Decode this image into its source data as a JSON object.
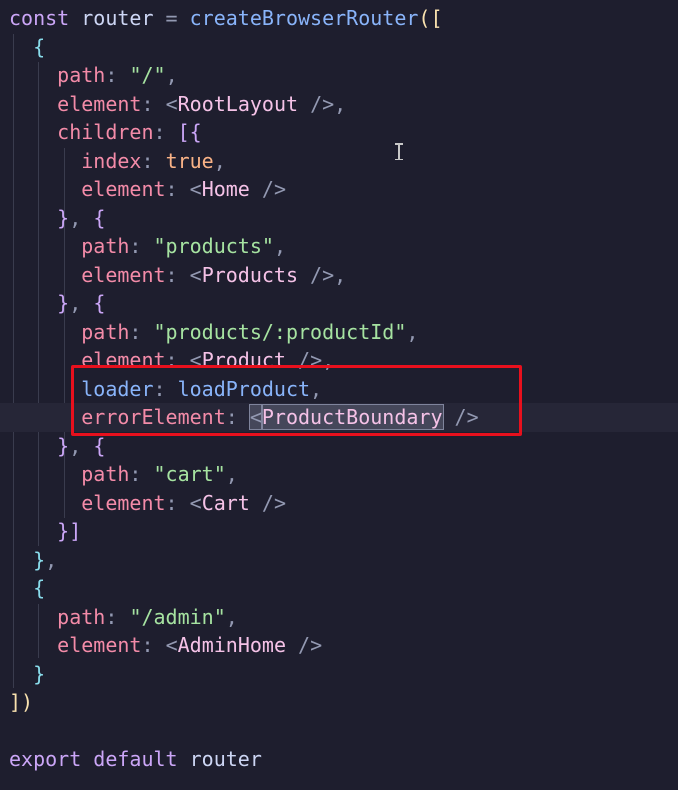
{
  "editor": {
    "language": "javascript",
    "theme_colors": {
      "background": "#1e1e2e",
      "keyword": "#cba6f7",
      "function": "#89b4fa",
      "property": "#f38ba8",
      "string": "#a6e3a1",
      "constant": "#fab387",
      "highlight_box": "#e8101d"
    },
    "lines": {
      "l1": {
        "kw1": "const",
        "name": "router",
        "eq": " = ",
        "fn": "createBrowserRouter",
        "open": "(["
      },
      "l2": {
        "brace": "{"
      },
      "l3": {
        "key": "path",
        "colon": ": ",
        "value": "\"/\"",
        "comma": ","
      },
      "l4": {
        "key": "element",
        "colon": ": ",
        "lt": "<",
        "tag": "RootLayout",
        "close": " />",
        "comma": ","
      },
      "l5": {
        "key": "children",
        "colon": ": ",
        "open": "[{"
      },
      "l6": {
        "key": "index",
        "colon": ": ",
        "value": "true",
        "comma": ","
      },
      "l7": {
        "key": "element",
        "colon": ": ",
        "lt": "<",
        "tag": "Home",
        "close": " />"
      },
      "l8": {
        "close": "}",
        "sep": ", ",
        "open": "{"
      },
      "l9": {
        "key": "path",
        "colon": ": ",
        "value": "\"products\"",
        "comma": ","
      },
      "l10": {
        "key": "element",
        "colon": ": ",
        "lt": "<",
        "tag": "Products",
        "close": " />",
        "comma": ","
      },
      "l11": {
        "close": "}",
        "sep": ", ",
        "open": "{"
      },
      "l12": {
        "key": "path",
        "colon": ": ",
        "value": "\"products/:productId\"",
        "comma": ","
      },
      "l13": {
        "key": "element",
        "colon": ": ",
        "lt": "<",
        "tag": "Product",
        "close": " />",
        "comma": ","
      },
      "l14": {
        "key": "loader",
        "colon": ": ",
        "value": "loadProduct",
        "comma": ","
      },
      "l15": {
        "key": "errorElement",
        "colon": ": ",
        "lt": "<",
        "tag": "ProductBoundary",
        "close": " />"
      },
      "l16": {
        "close": "}",
        "sep": ", ",
        "open": "{"
      },
      "l17": {
        "key": "path",
        "colon": ": ",
        "value": "\"cart\"",
        "comma": ","
      },
      "l18": {
        "key": "element",
        "colon": ": ",
        "lt": "<",
        "tag": "Cart",
        "close": " />"
      },
      "l19": {
        "close": "}]"
      },
      "l20": {
        "close": "}",
        "comma": ","
      },
      "l21": {
        "open": "{"
      },
      "l22": {
        "key": "path",
        "colon": ": ",
        "value": "\"/admin\"",
        "comma": ","
      },
      "l23": {
        "key": "element",
        "colon": ": ",
        "lt": "<",
        "tag": "AdminHome",
        "close": " />"
      },
      "l24": {
        "close": "}"
      },
      "l25": {
        "close": "])"
      },
      "l27": {
        "kw1": "export",
        "kw2": "default",
        "name": "router"
      }
    }
  }
}
